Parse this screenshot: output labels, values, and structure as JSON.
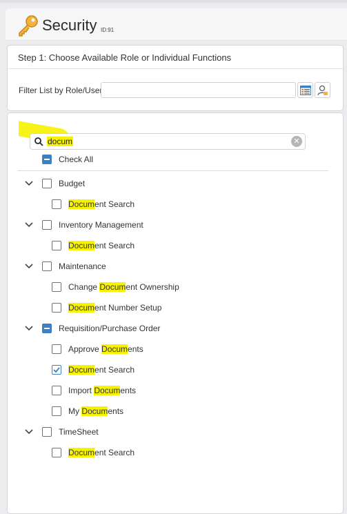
{
  "header": {
    "title": "Security",
    "id": "ID:91"
  },
  "step1": {
    "title": "Step 1: Choose Available Role or Individual Functions",
    "filter_label": "Filter List by Role/User",
    "filter_value": ""
  },
  "search": {
    "value": "docum"
  },
  "check_all": {
    "label": "Check All",
    "state": "partial"
  },
  "highlight_color": "#f6f200",
  "accent_color": "#3d7fc4",
  "groups": [
    {
      "label": "Budget",
      "state": "unchecked",
      "items": [
        {
          "pre": "",
          "match": "Docum",
          "post": "ent Search",
          "checked": false
        }
      ]
    },
    {
      "label": "Inventory Management",
      "state": "unchecked",
      "items": [
        {
          "pre": "",
          "match": "Docum",
          "post": "ent Search",
          "checked": false
        }
      ]
    },
    {
      "label": "Maintenance",
      "state": "unchecked",
      "items": [
        {
          "pre": "Change ",
          "match": "Docum",
          "post": "ent Ownership",
          "checked": false
        },
        {
          "pre": "",
          "match": "Docum",
          "post": "ent Number Setup",
          "checked": false
        }
      ]
    },
    {
      "label": "Requisition/Purchase Order",
      "state": "partial",
      "items": [
        {
          "pre": "Approve ",
          "match": "Docum",
          "post": "ents",
          "checked": false
        },
        {
          "pre": "",
          "match": "Docum",
          "post": "ent Search",
          "checked": true
        },
        {
          "pre": "Import ",
          "match": "Docum",
          "post": "ents",
          "checked": false
        },
        {
          "pre": "My ",
          "match": "Docum",
          "post": "ents",
          "checked": false
        }
      ]
    },
    {
      "label": "TimeSheet",
      "state": "unchecked",
      "items": [
        {
          "pre": "",
          "match": "Docum",
          "post": "ent Search",
          "checked": false
        }
      ]
    }
  ]
}
